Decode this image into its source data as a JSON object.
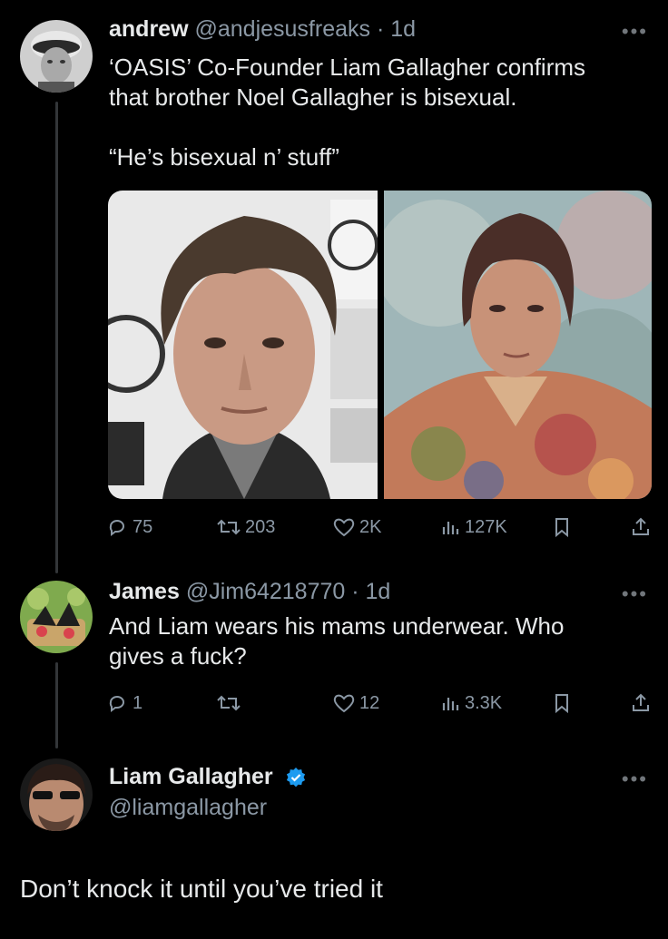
{
  "tweets": [
    {
      "name": "andrew",
      "handle": "@andjesusfreaks",
      "time": "1d",
      "text_line1": "‘OASIS’ Co-Founder Liam Gallagher confirms",
      "text_line2": "that brother Noel Gallagher is bisexual.",
      "quote": "“He’s bisexual n’ stuff”",
      "replies": "75",
      "reposts": "203",
      "likes": "2K",
      "views": "127K"
    },
    {
      "name": "James",
      "handle": "@Jim64218770",
      "time": "1d",
      "text_line1": "And Liam wears his mams underwear. Who",
      "text_line2": "gives a fuck?",
      "replies": "1",
      "reposts": "",
      "likes": "12",
      "views": "3.3K"
    },
    {
      "name": "Liam Gallagher",
      "handle": "@liamgallagher",
      "text": "Don’t knock it until you’ve tried it"
    }
  ],
  "icons": {
    "reply": "reply-icon",
    "repost": "repost-icon",
    "like": "heart-icon",
    "views": "views-icon",
    "bookmark": "bookmark-icon",
    "share": "share-icon",
    "more": "more-icon",
    "verified": "verified-badge-icon"
  },
  "colors": {
    "background": "#000000",
    "text": "#e7e9ea",
    "secondary": "#8b98a5",
    "verified": "#1d9bf0"
  }
}
